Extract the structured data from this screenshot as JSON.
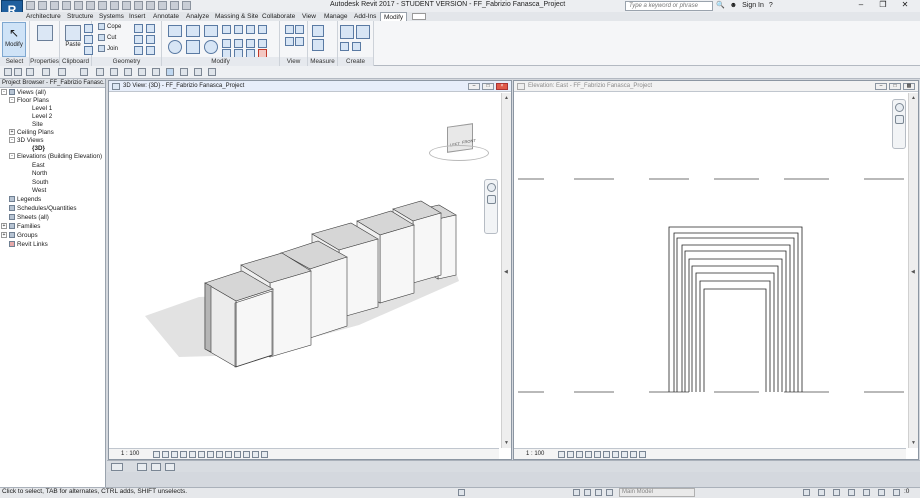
{
  "app": {
    "logo_letter": "R",
    "title": "Autodesk Revit 2017 - STUDENT VERSION -   FF_Fabrizio Fanasca_Project",
    "search_placeholder": "Type a keyword or phrase",
    "sign_in": "Sign In",
    "help": "?"
  },
  "tabs": [
    "Architecture",
    "Structure",
    "Systems",
    "Insert",
    "Annotate",
    "Analyze",
    "Massing & Site",
    "Collaborate",
    "View",
    "Manage",
    "Add-Ins",
    "Modify"
  ],
  "active_tab": "Modify",
  "ribbon": {
    "modify_label": "Modify",
    "paste_label": "Paste",
    "cope_label": "Cope",
    "cut_label": "Cut",
    "join_label": "Join",
    "panels": [
      "Select",
      "Properties",
      "Clipboard",
      "Geometry",
      "Modify",
      "View",
      "Measure",
      "Create"
    ]
  },
  "project_browser": {
    "title": "Project Browser - FF_Fabrizio Fanasc...",
    "tree": [
      "Views (all)",
      "Floor Plans",
      "Level 1",
      "Level 2",
      "Site",
      "Ceiling Plans",
      "3D Views",
      "{3D}",
      "Elevations (Building Elevation)",
      "East",
      "North",
      "South",
      "West",
      "Legends",
      "Schedules/Quantities",
      "Sheets (all)",
      "Families",
      "Groups",
      "Revit Links"
    ],
    "selected": "{3D}"
  },
  "view3d": {
    "title": "3D View: {3D} - FF_Fabrizio Fanasca_Project",
    "scale": "1 : 100",
    "viewcube_left": "LEFT",
    "viewcube_front": "FRONT"
  },
  "elevation": {
    "title": "Elevation: East - FF_Fabrizio Fanasca_Project",
    "scale": "1 : 100"
  },
  "statusbar": {
    "hint": "Click to select, TAB for alternates, CTRL adds, SHIFT unselects.",
    "workset": "Main Model",
    "filter_count": ":0"
  }
}
